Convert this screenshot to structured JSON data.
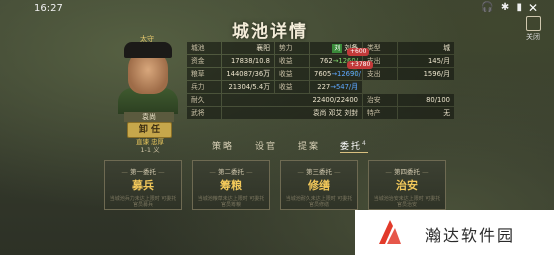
{
  "status_bar": {
    "time": "16:27",
    "sys_icons": "🎧 ✱ ▮",
    "close": "✕"
  },
  "exit_label": "关闭",
  "title": "城池详情",
  "governor": {
    "role": "太守",
    "name": "袁尚",
    "appoint_label": "卸 任",
    "trait1": "直谏 忠厚",
    "trait2": "1-1 义"
  },
  "info": {
    "city_label": "城池",
    "city_value": "襄阳",
    "force_label": "势力",
    "force_badge": "刘",
    "force_value": "刘备",
    "type_label": "类型",
    "type_value": "城",
    "money_label": "资金",
    "money_value": "17838/10.8万",
    "money_income_label": "收益",
    "money_income_a": "762",
    "money_income_arrow": "→",
    "money_income_b": "1260/月",
    "money_bubble": "+600",
    "money_expense_label": "支出",
    "money_expense_value": "145/月",
    "food_label": "粮草",
    "food_value": "144087/36万",
    "food_income_label": "收益",
    "food_income_a": "7605",
    "food_income_arrow": "→",
    "food_income_b": "12690/月",
    "food_bubble": "+3780",
    "food_expense_label": "支出",
    "food_expense_value": "1596/月",
    "troops_label": "兵力",
    "troops_value": "21304/5.4万",
    "troops_income_label": "收益",
    "troops_income_a": "227",
    "troops_income_arrow": "→",
    "troops_income_b": "547/月",
    "durability_label": "耐久",
    "durability_value": "22400/22400",
    "order_label": "治安",
    "order_value": "80/100",
    "generals_label": "武将",
    "generals_value": "袁尚 邓艾 刘封",
    "specialty_label": "特产",
    "specialty_value": "无"
  },
  "tabs": [
    {
      "label": "策略"
    },
    {
      "label": "设官"
    },
    {
      "label": "提案"
    },
    {
      "label": "委托",
      "count": "4"
    }
  ],
  "cards": [
    {
      "num": "第一委托",
      "title": "募兵",
      "desc": "当城池兵力未达上限时 可委托官员募兵"
    },
    {
      "num": "第二委托",
      "title": "筹粮",
      "desc": "当城池粮草未达上限时 可委托官员筹粮"
    },
    {
      "num": "第三委托",
      "title": "修缮",
      "desc": "当城池耐久未达上限时 可委托官员修缮"
    },
    {
      "num": "第四委托",
      "title": "治安",
      "desc": "当城池治安未达上限时 可委托官员治安"
    }
  ],
  "watermark": {
    "text": "瀚达软件园"
  },
  "colors": {
    "accent_gold": "#f2c85a",
    "income_green": "#7fd66a",
    "income_blue": "#5fa8ff",
    "bubble_red": "#c23a3a"
  }
}
